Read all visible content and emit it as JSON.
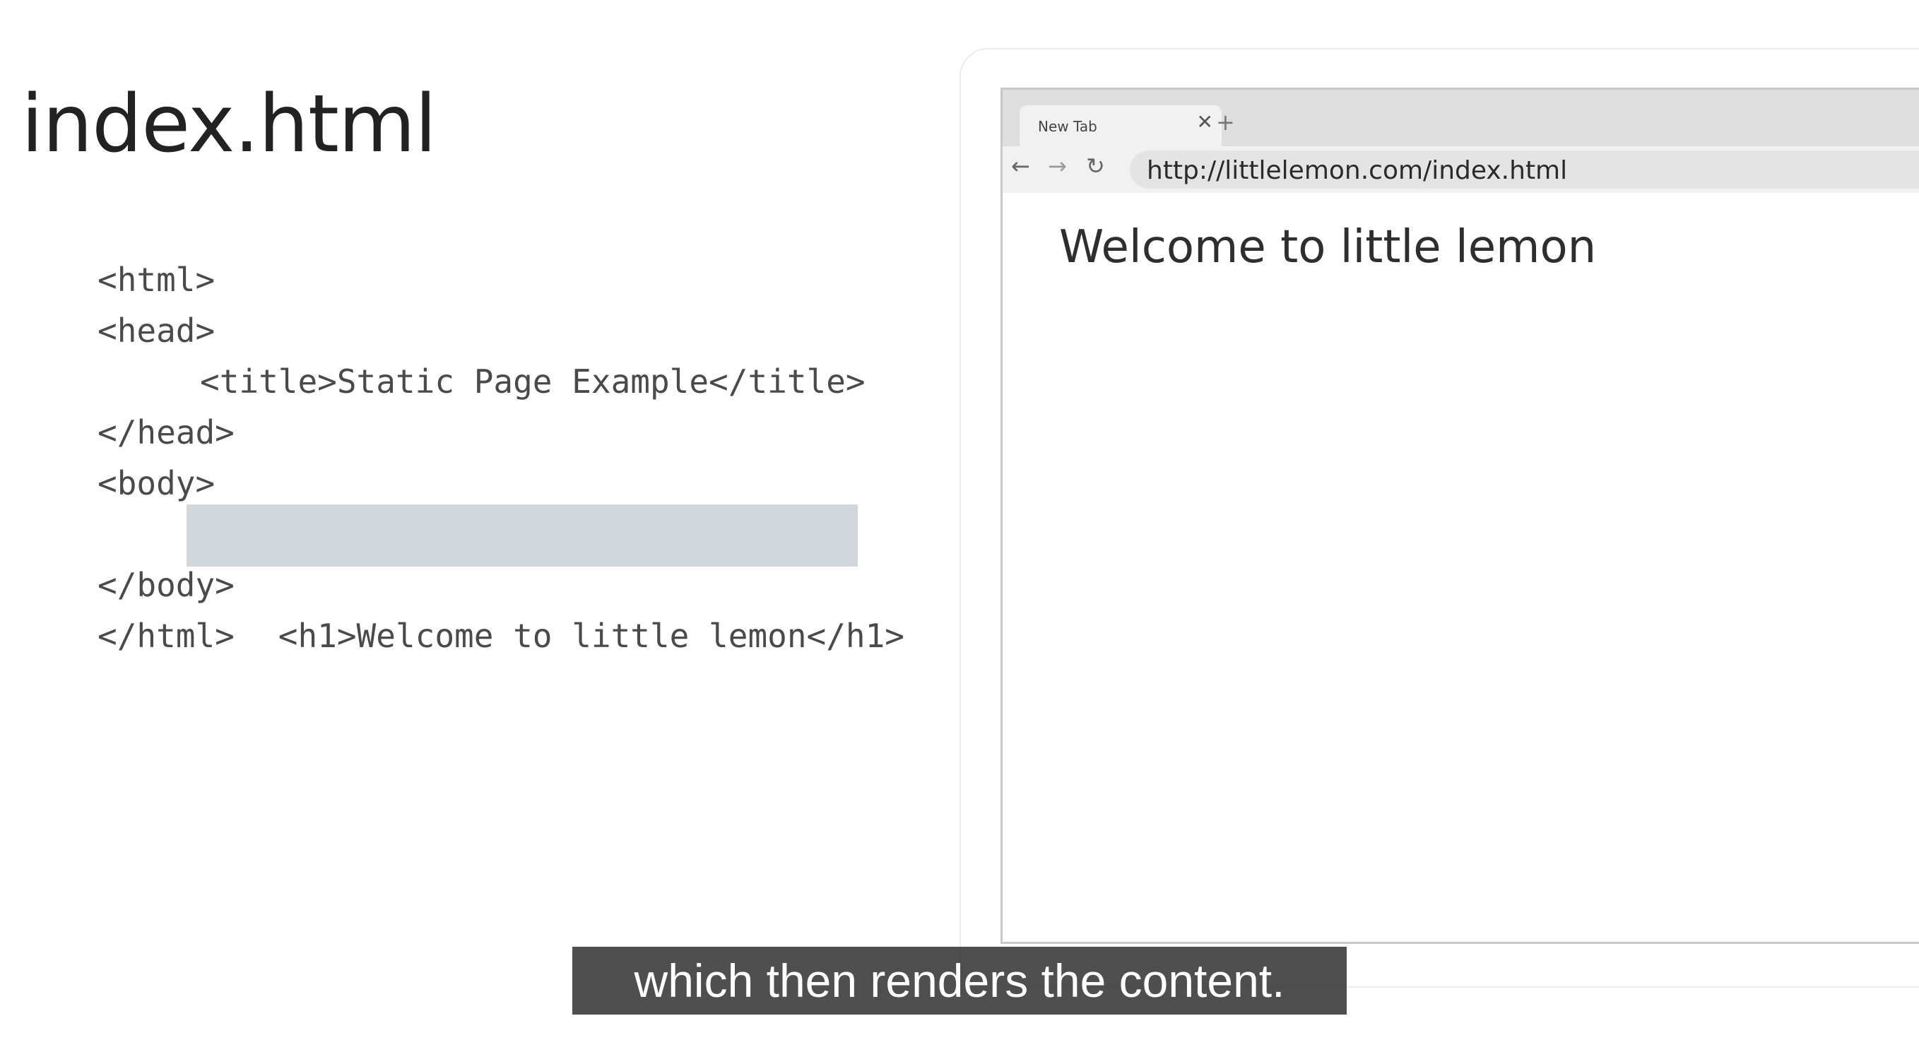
{
  "slide": {
    "title": "index.html"
  },
  "code": {
    "lines": [
      "<html>",
      "<head>",
      "<title>Static Page Example</title>",
      "</head>",
      "<body>",
      "<h1>Welcome to little lemon</h1>",
      "</body>",
      "</html>"
    ],
    "highlight_color": "#cfd6dc"
  },
  "browser": {
    "tab_title": "New Tab",
    "tab_close_icon": "close-icon",
    "new_tab_icon": "plus-icon",
    "back_icon": "arrow-left-icon",
    "forward_icon": "arrow-right-icon",
    "reload_icon": "reload-icon",
    "address": "http://littlelemon.com/index.html",
    "page_heading": "Welcome to little lemon"
  },
  "caption": {
    "text": "which then renders the content."
  }
}
